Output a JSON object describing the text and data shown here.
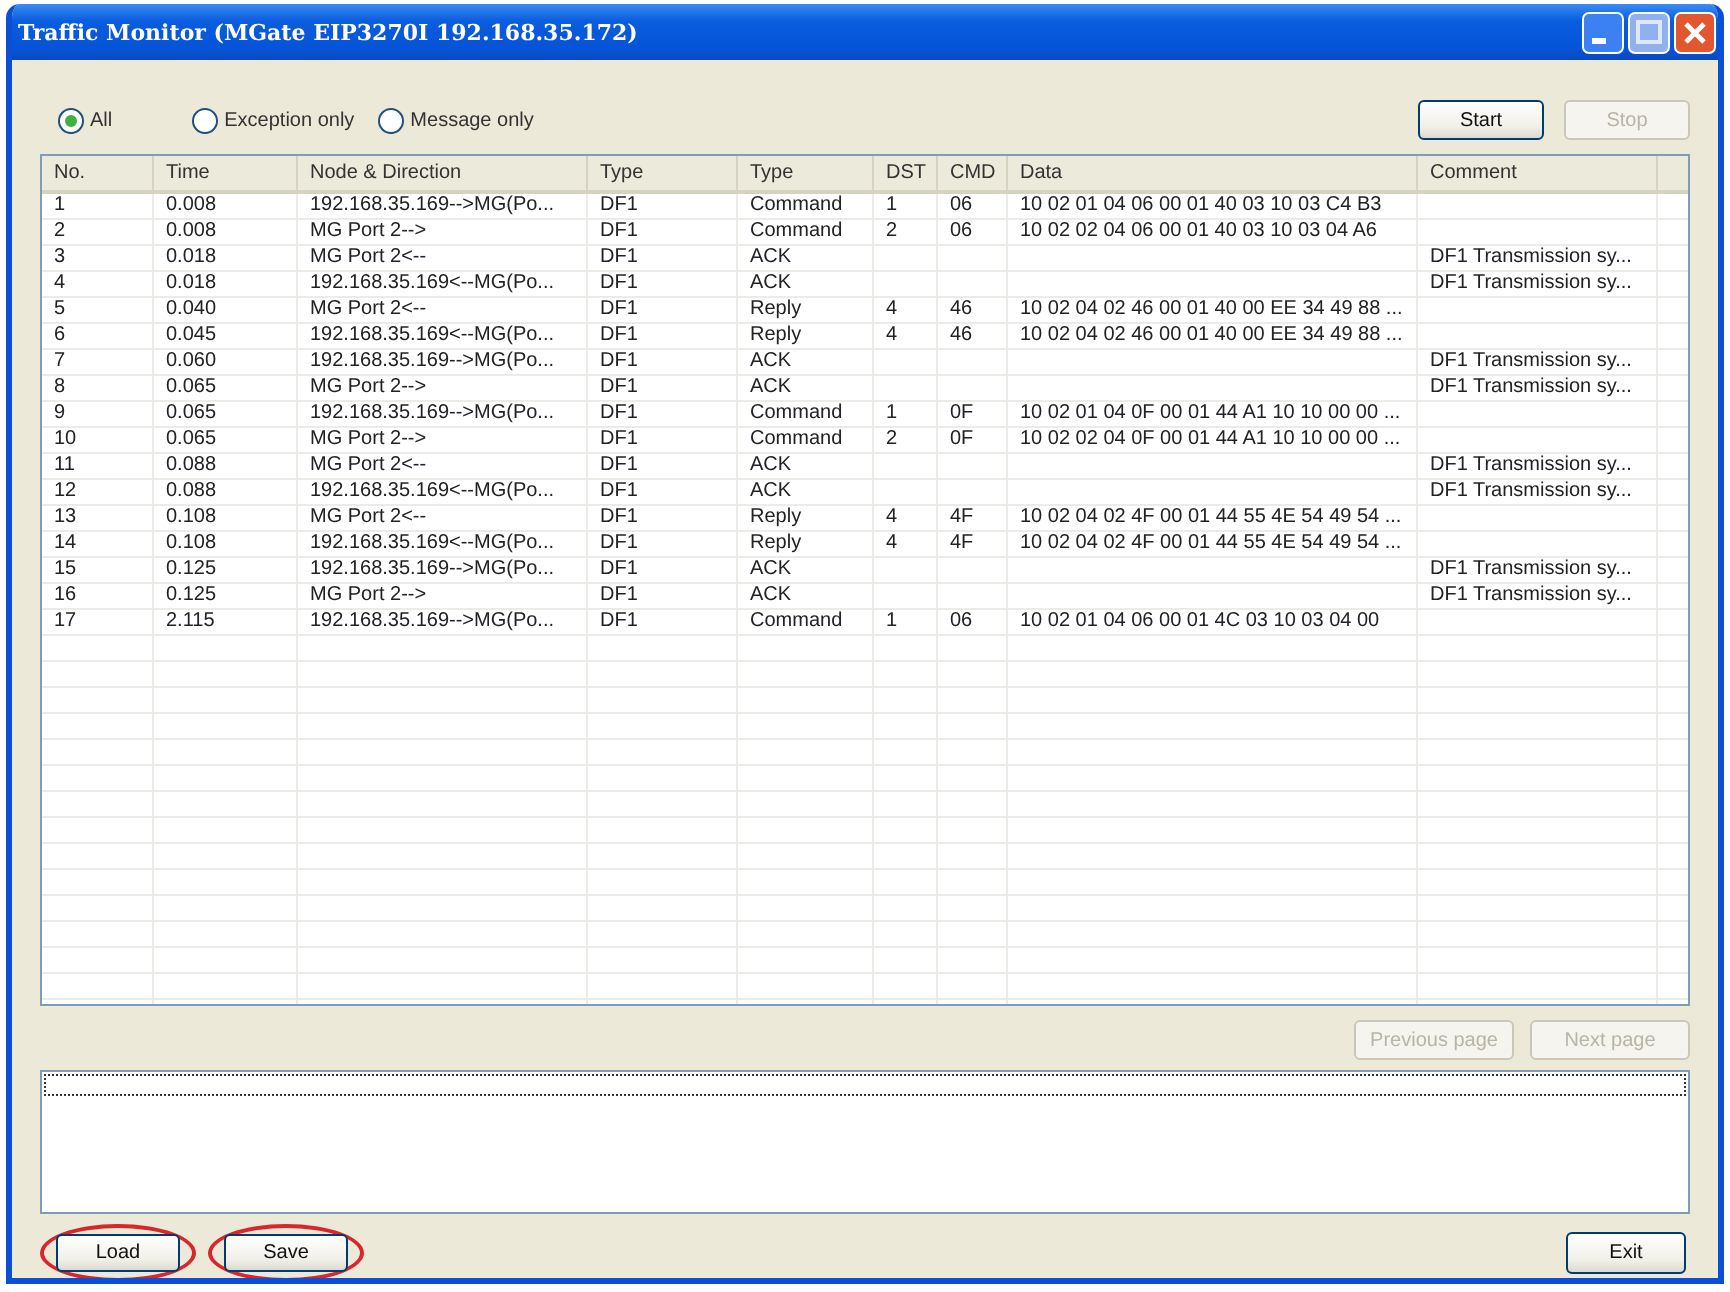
{
  "window": {
    "title": "Traffic Monitor (MGate EIP3270I 192.168.35.172)"
  },
  "filters": [
    {
      "label": "All",
      "selected": true
    },
    {
      "label": "Exception only",
      "selected": false
    },
    {
      "label": "Message only",
      "selected": false
    }
  ],
  "top_buttons": [
    {
      "label": "Start",
      "disabled": false
    },
    {
      "label": "Stop",
      "disabled": true
    }
  ],
  "table": {
    "columns": [
      "No.",
      "Time",
      "Node & Direction",
      "Type",
      "Type",
      "DST",
      "CMD",
      "Data",
      "Comment"
    ],
    "rows": [
      {
        "no": "1",
        "time": "0.008",
        "node_direction": "192.168.35.169-->MG(Po...",
        "type_1": "DF1",
        "type_2": "Command",
        "dst": "1",
        "cmd": "06",
        "data": "10 02 01 04 06 00 01 40 03 10 03 C4 B3"
      },
      {
        "no": "2",
        "time": "0.008",
        "node_direction": "MG Port 2-->",
        "type_1": "DF1",
        "type_2": "Command",
        "dst": "2",
        "cmd": "06",
        "data": "10 02 02 04 06 00 01 40 03 10 03 04 A6"
      },
      {
        "no": "3",
        "time": "0.018",
        "node_direction": "MG Port 2<--",
        "type_1": "DF1",
        "type_2": "ACK",
        "comment": "DF1 Transmission sy..."
      },
      {
        "no": "4",
        "time": "0.018",
        "node_direction": "192.168.35.169<--MG(Po...",
        "type_1": "DF1",
        "type_2": "ACK",
        "comment": "DF1 Transmission sy..."
      },
      {
        "no": "5",
        "time": "0.040",
        "node_direction": "MG Port 2<--",
        "type_1": "DF1",
        "type_2": "Reply",
        "dst": "4",
        "cmd": "46",
        "data": "10 02 04 02 46 00 01 40 00 EE 34 49 88 ..."
      },
      {
        "no": "6",
        "time": "0.045",
        "node_direction": "192.168.35.169<--MG(Po...",
        "type_1": "DF1",
        "type_2": "Reply",
        "dst": "4",
        "cmd": "46",
        "data": "10 02 04 02 46 00 01 40 00 EE 34 49 88 ..."
      },
      {
        "no": "7",
        "time": "0.060",
        "node_direction": "192.168.35.169-->MG(Po...",
        "type_1": "DF1",
        "type_2": "ACK",
        "comment": "DF1 Transmission sy..."
      },
      {
        "no": "8",
        "time": "0.065",
        "node_direction": "MG Port 2-->",
        "type_1": "DF1",
        "type_2": "ACK",
        "comment": "DF1 Transmission sy..."
      },
      {
        "no": "9",
        "time": "0.065",
        "node_direction": "192.168.35.169-->MG(Po...",
        "type_1": "DF1",
        "type_2": "Command",
        "dst": "1",
        "cmd": "0F",
        "data": "10 02 01 04 0F 00 01 44 A1 10 10 00 00 ..."
      },
      {
        "no": "10",
        "time": "0.065",
        "node_direction": "MG Port 2-->",
        "type_1": "DF1",
        "type_2": "Command",
        "dst": "2",
        "cmd": "0F",
        "data": "10 02 02 04 0F 00 01 44 A1 10 10 00 00 ..."
      },
      {
        "no": "11",
        "time": "0.088",
        "node_direction": "MG Port 2<--",
        "type_1": "DF1",
        "type_2": "ACK",
        "comment": "DF1 Transmission sy..."
      },
      {
        "no": "12",
        "time": "0.088",
        "node_direction": "192.168.35.169<--MG(Po...",
        "type_1": "DF1",
        "type_2": "ACK",
        "comment": "DF1 Transmission sy..."
      },
      {
        "no": "13",
        "time": "0.108",
        "node_direction": "MG Port 2<--",
        "type_1": "DF1",
        "type_2": "Reply",
        "dst": "4",
        "cmd": "4F",
        "data": "10 02 04 02 4F 00 01 44 55 4E 54 49 54 ..."
      },
      {
        "no": "14",
        "time": "0.108",
        "node_direction": "192.168.35.169<--MG(Po...",
        "type_1": "DF1",
        "type_2": "Reply",
        "dst": "4",
        "cmd": "4F",
        "data": "10 02 04 02 4F 00 01 44 55 4E 54 49 54 ..."
      },
      {
        "no": "15",
        "time": "0.125",
        "node_direction": "192.168.35.169-->MG(Po...",
        "type_1": "DF1",
        "type_2": "ACK",
        "comment": "DF1 Transmission sy..."
      },
      {
        "no": "16",
        "time": "0.125",
        "node_direction": "MG Port 2-->",
        "type_1": "DF1",
        "type_2": "ACK",
        "comment": "DF1 Transmission sy..."
      },
      {
        "no": "17",
        "time": "2.115",
        "node_direction": "192.168.35.169-->MG(Po...",
        "type_1": "DF1",
        "type_2": "Command",
        "dst": "1",
        "cmd": "06",
        "data": "10 02 01 04 06 00 01 4C 03 10 03 04 00"
      }
    ]
  },
  "pager": [
    {
      "label": "Previous page",
      "disabled": true
    },
    {
      "label": "Next page",
      "disabled": true
    }
  ],
  "log_area": {
    "focused": true
  },
  "bottom_buttons": [
    {
      "label": "Load",
      "highlighted": true
    },
    {
      "label": "Save",
      "highlighted": true
    },
    {
      "label": "Exit",
      "highlighted": false
    }
  ]
}
